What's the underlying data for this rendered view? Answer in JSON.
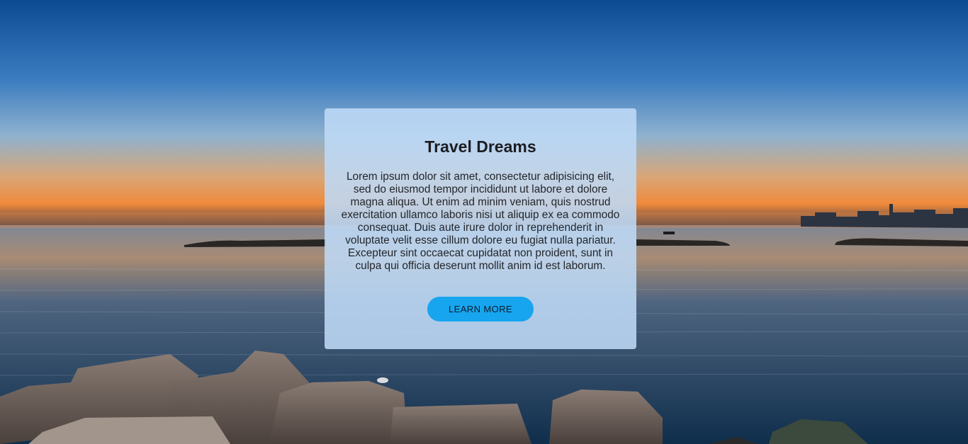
{
  "hero": {
    "title": "Travel Dreams",
    "body": "Lorem ipsum dolor sit amet, consectetur adipisicing elit, sed do eiusmod tempor incididunt ut labore et dolore magna aliqua. Ut enim ad minim veniam, quis nostrud exercitation ullamco laboris nisi ut aliquip ex ea commodo consequat. Duis aute irure dolor in reprehenderit in voluptate velit esse cillum dolore eu fugiat nulla pariatur. Excepteur sint occaecat cupidatat non proident, sunt in culpa qui officia deserunt mollit anim id est laborum.",
    "button_label": "LEARN MORE"
  },
  "colors": {
    "button": "#16a5ee",
    "card_background": "#bedaf6"
  },
  "background": "sunset-sea-with-rocks"
}
